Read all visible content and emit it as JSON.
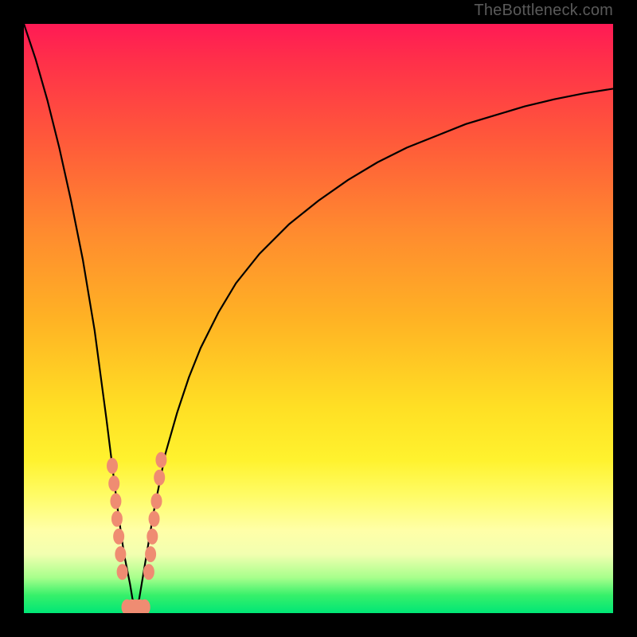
{
  "watermark": "TheBottleneck.com",
  "colors": {
    "frame": "#000000",
    "curve": "#000000",
    "marker": "#ef8c72",
    "watermark_text": "#5a5a5a"
  },
  "chart_data": {
    "type": "line",
    "title": "",
    "xlabel": "",
    "ylabel": "",
    "xlim": [
      0,
      100
    ],
    "ylim": [
      0,
      100
    ],
    "note": "Bottleneck-style V curve. y≈0 at x≈19 (minimum), y rises steeply to ~100 as x→0 and rises asymptotically toward ~90 as x→100. Values estimated from pixel positions (axes unlabeled).",
    "series": [
      {
        "name": "curve",
        "x": [
          0,
          2,
          4,
          6,
          8,
          10,
          12,
          14,
          15,
          16,
          17,
          18,
          18.5,
          19,
          19.5,
          20,
          21,
          22,
          23,
          24,
          26,
          28,
          30,
          33,
          36,
          40,
          45,
          50,
          55,
          60,
          65,
          70,
          75,
          80,
          85,
          90,
          95,
          100
        ],
        "y": [
          100,
          94,
          87,
          79,
          70,
          60,
          48,
          33,
          25,
          17,
          10,
          5,
          2,
          0,
          2,
          5,
          11,
          17,
          22,
          27,
          34,
          40,
          45,
          51,
          56,
          61,
          66,
          70,
          73.5,
          76.5,
          79,
          81,
          83,
          84.5,
          86,
          87.2,
          88.2,
          89
        ]
      }
    ],
    "markers": {
      "name": "highlighted-points",
      "note": "Salmon oval markers clustered near the minimum on both branches and along the bottom.",
      "points_xy": [
        [
          15.0,
          25
        ],
        [
          15.3,
          22
        ],
        [
          15.6,
          19
        ],
        [
          15.8,
          16
        ],
        [
          16.1,
          13
        ],
        [
          16.4,
          10
        ],
        [
          16.7,
          7
        ],
        [
          17.5,
          1
        ],
        [
          18.3,
          1
        ],
        [
          19.0,
          1
        ],
        [
          19.7,
          1
        ],
        [
          20.5,
          1
        ],
        [
          21.2,
          7
        ],
        [
          21.5,
          10
        ],
        [
          21.8,
          13
        ],
        [
          22.1,
          16
        ],
        [
          22.5,
          19
        ],
        [
          23.0,
          23
        ],
        [
          23.3,
          26
        ]
      ]
    }
  }
}
